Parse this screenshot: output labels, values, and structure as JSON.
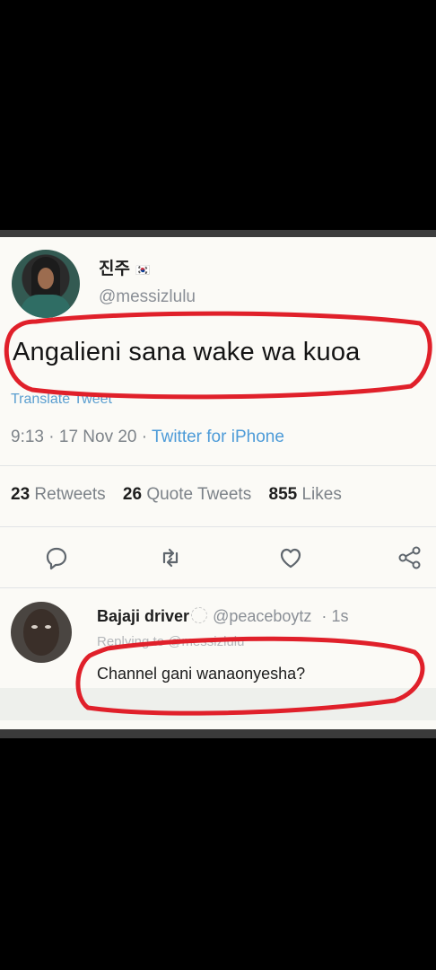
{
  "tweet": {
    "display_name": "진주",
    "flag": "🇰🇷",
    "handle": "@messizlulu",
    "text": "Angalieni sana wake wa kuoa",
    "translate_label": "Translate Tweet",
    "time": "9:13",
    "date": "17 Nov 20",
    "source": "Twitter for iPhone",
    "separator": "·",
    "stats": {
      "retweets_count": "23",
      "retweets_label": "Retweets",
      "quotes_count": "26",
      "quotes_label": "Quote Tweets",
      "likes_count": "855",
      "likes_label": "Likes"
    },
    "icons": [
      "reply-icon",
      "retweet-icon",
      "like-icon",
      "share-icon"
    ]
  },
  "reply": {
    "display_name": "Bajaji driver",
    "handle": "@peaceboytz",
    "age": "1s",
    "separator": "·",
    "replying_to": "Replying to @messizlulu",
    "text": "Channel gani wanaonyesha?"
  },
  "colors": {
    "link": "#4d9bd8",
    "annotation": "#e0202a",
    "muted": "#7d8389"
  }
}
